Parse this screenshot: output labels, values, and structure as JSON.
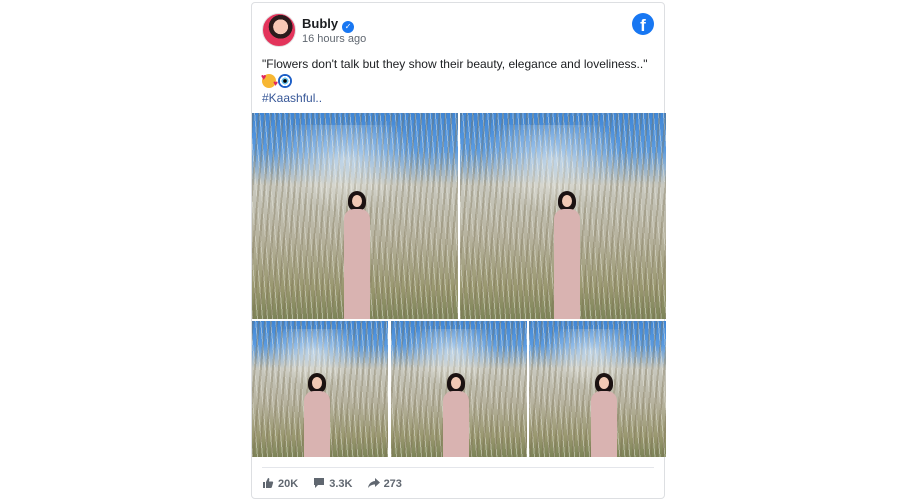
{
  "post": {
    "author": "Bubly",
    "verified": true,
    "time": "16 hours ago",
    "text": "\"Flowers don't talk but they show their beauty, elegance and loveliness..\"",
    "hashtag": "#Kaashful..",
    "emojis": [
      "smiling-face-with-hearts",
      "nazar-amulet"
    ],
    "brand_logo": "facebook-logo",
    "photo_count": 5
  },
  "stats": {
    "likes": "20K",
    "comments": "3.3K",
    "shares": "273"
  },
  "colors": {
    "brand_blue": "#1877f2",
    "link": "#385898",
    "muted": "#606770"
  }
}
